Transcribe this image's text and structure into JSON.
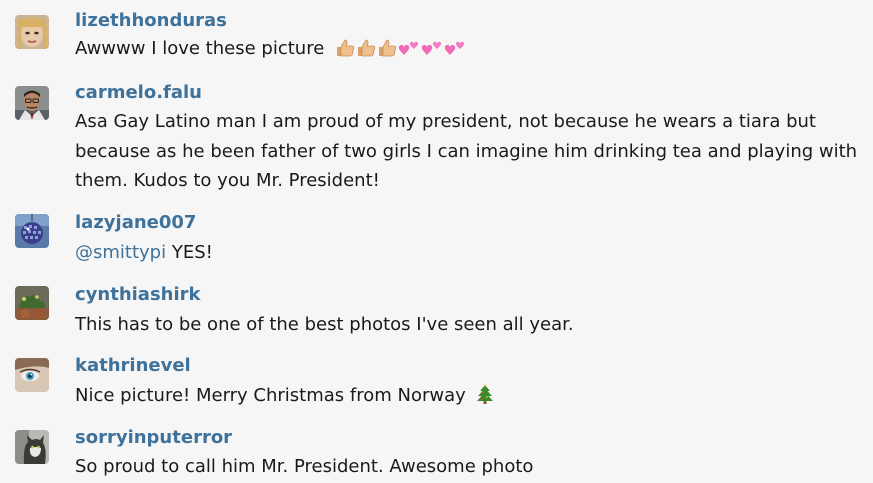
{
  "comments": [
    {
      "username": "lizethhonduras",
      "text": "Awwww I love these picture",
      "emoji": [
        "thumbs-up-icon",
        "thumbs-up-icon",
        "thumbs-up-icon",
        "two-hearts-icon",
        "two-hearts-icon",
        "two-hearts-icon"
      ],
      "avatar": "profile-photo-woman-bangs"
    },
    {
      "username": "carmelo.falu",
      "text": "Asa Gay Latino man I am proud of my president, not because he wears a tiara but because as he been father of two girls I can imagine him drinking tea and playing with them. Kudos to you Mr. President!",
      "avatar": "profile-photo-man-glasses"
    },
    {
      "username": "lazyjane007",
      "mention": "@smittypi",
      "text": " YES!",
      "avatar": "profile-photo-disco-ball"
    },
    {
      "username": "cynthiashirk",
      "text": "This has to be one of the best photos I've seen all year.",
      "avatar": "profile-photo-plants"
    },
    {
      "username": "kathrinevel",
      "text": "Nice picture! Merry Christmas from Norway",
      "emoji": [
        "christmas-tree-icon"
      ],
      "avatar": "profile-photo-blue-eye"
    },
    {
      "username": "sorryinputerror",
      "text": "So proud to call him Mr. President. Awesome photo",
      "avatar": "profile-photo-cat"
    }
  ],
  "colors": {
    "background": "#f6f6f6",
    "username": "#3f729b",
    "mention": "#3f729b",
    "text": "#1a1a1a"
  }
}
